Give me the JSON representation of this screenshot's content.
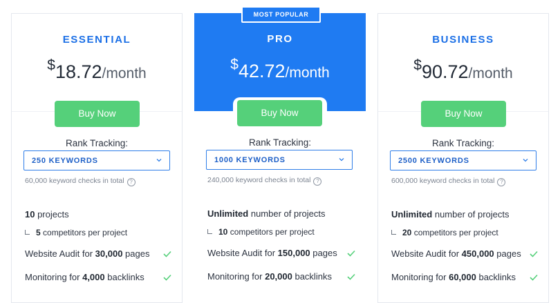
{
  "badge": "MOST POPULAR",
  "plans": [
    {
      "name": "ESSENTIAL",
      "currency": "$",
      "amount": "18.72",
      "period": "/month",
      "buy_label": "Buy Now",
      "rank_label": "Rank Tracking:",
      "keywords": "250 KEYWORDS",
      "checks_text": "60,000 keyword checks in total",
      "projects_bold": "10",
      "projects_rest": " projects",
      "competitors_bold": "5",
      "competitors_rest": " competitors per project",
      "audit_pre": "Website Audit for ",
      "audit_bold": "30,000",
      "audit_post": " pages",
      "monitor_pre": "Monitoring for ",
      "monitor_bold": "4,000",
      "monitor_post": " backlinks"
    },
    {
      "name": "PRO",
      "currency": "$",
      "amount": "42.72",
      "period": "/month",
      "buy_label": "Buy Now",
      "rank_label": "Rank Tracking:",
      "keywords": "1000 KEYWORDS",
      "checks_text": "240,000 keyword checks in total",
      "projects_bold": "Unlimited",
      "projects_rest": " number of projects",
      "competitors_bold": "10",
      "competitors_rest": " competitors per project",
      "audit_pre": "Website Audit for ",
      "audit_bold": "150,000",
      "audit_post": " pages",
      "monitor_pre": "Monitoring for ",
      "monitor_bold": "20,000",
      "monitor_post": " backlinks"
    },
    {
      "name": "BUSINESS",
      "currency": "$",
      "amount": "90.72",
      "period": "/month",
      "buy_label": "Buy Now",
      "rank_label": "Rank Tracking:",
      "keywords": "2500 KEYWORDS",
      "checks_text": "600,000 keyword checks in total",
      "projects_bold": "Unlimited",
      "projects_rest": " number of projects",
      "competitors_bold": "20",
      "competitors_rest": " competitors per project",
      "audit_pre": "Website Audit for ",
      "audit_bold": "450,000",
      "audit_post": " pages",
      "monitor_pre": "Monitoring for ",
      "monitor_bold": "60,000",
      "monitor_post": " backlinks"
    }
  ],
  "icons": {
    "help": "question-circle-icon",
    "dropdown": "chevron-down-icon",
    "check": "check-icon",
    "sub": "sub-item-arrow-icon"
  },
  "colors": {
    "accent": "#1f7bf2",
    "buy_button": "#55d07a",
    "check": "#55d07a"
  }
}
